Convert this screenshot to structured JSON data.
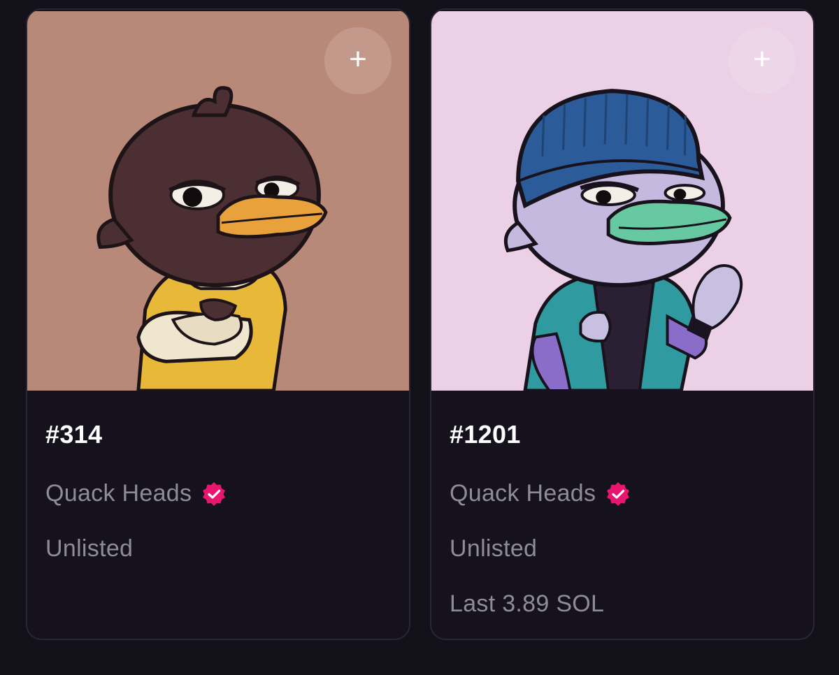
{
  "cards": [
    {
      "title": "#314",
      "collection": "Quack Heads",
      "status": "Unlisted",
      "last_sale": "",
      "add_symbol": "+",
      "background_color": "#b88978",
      "icons": [
        "plus-icon",
        "verified-badge-icon"
      ]
    },
    {
      "title": "#1201",
      "collection": "Quack Heads",
      "status": "Unlisted",
      "last_sale": "Last 3.89 SOL",
      "add_symbol": "+",
      "background_color": "#ecd0e6",
      "icons": [
        "plus-icon",
        "verified-badge-icon"
      ]
    }
  ],
  "colors": {
    "page_background": "#121019",
    "card_background": "#15121d",
    "verified_badge": "#e8166f",
    "muted_text": "#8f8c99"
  }
}
